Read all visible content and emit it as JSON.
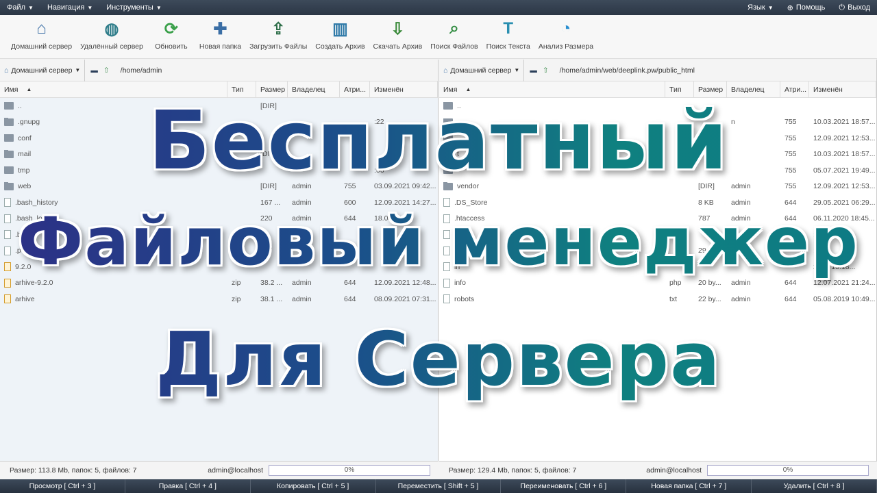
{
  "menubar": {
    "file": "Файл",
    "nav": "Навигация",
    "tools": "Инструменты",
    "lang": "Язык",
    "help": "Помощь",
    "exit": "Выход"
  },
  "toolbar": [
    {
      "label": "Домашний сервер",
      "icon": "home-icon"
    },
    {
      "label": "Удалённый сервер",
      "icon": "remote-server-icon"
    },
    {
      "label": "Обновить",
      "icon": "refresh-icon"
    },
    {
      "label": "Новая папка",
      "icon": "new-folder-icon"
    },
    {
      "label": "Загрузить Файлы",
      "icon": "upload-icon"
    },
    {
      "label": "Создать Архив",
      "icon": "archive-icon"
    },
    {
      "label": "Скачать Архив",
      "icon": "download-archive-icon"
    },
    {
      "label": "Поиск Файлов",
      "icon": "search-files-icon"
    },
    {
      "label": "Поиск Текста",
      "icon": "search-text-icon"
    },
    {
      "label": "Анализ Размера",
      "icon": "size-analysis-icon"
    }
  ],
  "left": {
    "server": "Домашний сервер",
    "path": "/home/admin",
    "columns": [
      "Имя",
      "Тип",
      "Размер",
      "Владелец",
      "Атри...",
      "Изменён"
    ],
    "rows": [
      {
        "kind": "folder",
        "name": "..",
        "type": "",
        "size": "[DIR]",
        "owner": "",
        "attr": "",
        "date": ""
      },
      {
        "kind": "folder",
        "name": ".gnupg",
        "type": "",
        "size": "",
        "owner": "",
        "attr": "",
        "date": ":22"
      },
      {
        "kind": "folder",
        "name": "conf",
        "type": "",
        "size": "",
        "owner": "",
        "attr": "",
        "date": ""
      },
      {
        "kind": "folder",
        "name": "mail",
        "type": "",
        "size": "[DIR]",
        "owner": "",
        "attr": "",
        "date": ""
      },
      {
        "kind": "folder",
        "name": "tmp",
        "type": "",
        "size": "",
        "owner": "",
        "attr": "",
        "date": ":06"
      },
      {
        "kind": "folder",
        "name": "web",
        "type": "",
        "size": "[DIR]",
        "owner": "admin",
        "attr": "755",
        "date": "03.09.2021 09:42..."
      },
      {
        "kind": "file",
        "name": ".bash_history",
        "type": "",
        "size": "167 ...",
        "owner": "admin",
        "attr": "600",
        "date": "12.09.2021 14:27..."
      },
      {
        "kind": "file",
        "name": ".bash_log",
        "type": "",
        "size": "220",
        "owner": "admin",
        "attr": "644",
        "date": "18.04.201"
      },
      {
        "kind": "file",
        "name": ".ba",
        "type": "",
        "size": "",
        "owner": "",
        "attr": "",
        "date": ""
      },
      {
        "kind": "file",
        "name": ".p",
        "type": "",
        "size": "807",
        "owner": "",
        "attr": "",
        "date": ""
      },
      {
        "kind": "zip",
        "name": "9.2.0",
        "type": "",
        "size": "",
        "owner": "",
        "attr": "",
        "date": ""
      },
      {
        "kind": "zip",
        "name": "arhive-9.2.0",
        "type": "zip",
        "size": "38.2 ...",
        "owner": "admin",
        "attr": "644",
        "date": "12.09.2021 12:48..."
      },
      {
        "kind": "zip",
        "name": "arhive",
        "type": "zip",
        "size": "38.1 ...",
        "owner": "admin",
        "attr": "644",
        "date": "08.09.2021 07:31..."
      }
    ],
    "status": "Размер: 113.8 Mb, папок: 5, файлов: 7",
    "user": "admin@localhost",
    "progress": "0%"
  },
  "right": {
    "server": "Домашний сервер",
    "path": "/home/admin/web/deeplink.pw/public_html",
    "columns": [
      "Имя",
      "Тип",
      "Размер",
      "Владелец",
      "Атри...",
      "Изменён"
    ],
    "rows": [
      {
        "kind": "folder",
        "name": "..",
        "type": "",
        "size": "",
        "owner": "",
        "attr": "",
        "date": ""
      },
      {
        "kind": "folder",
        "name": "",
        "type": "",
        "size": "",
        "owner": "n",
        "attr": "755",
        "date": "10.03.2021 18:57..."
      },
      {
        "kind": "folder",
        "name": "",
        "type": "",
        "size": "",
        "owner": "",
        "attr": "755",
        "date": "12.09.2021 12:53..."
      },
      {
        "kind": "folder",
        "name": "t",
        "type": "",
        "size": "",
        "owner": "",
        "attr": "755",
        "date": "10.03.2021 18:57..."
      },
      {
        "kind": "folder",
        "name": "",
        "type": "",
        "size": "",
        "owner": "",
        "attr": "755",
        "date": "05.07.2021 19:49..."
      },
      {
        "kind": "folder",
        "name": "vendor",
        "type": "",
        "size": "[DIR]",
        "owner": "admin",
        "attr": "755",
        "date": "12.09.2021 12:53..."
      },
      {
        "kind": "file",
        "name": ".DS_Store",
        "type": "",
        "size": "8 KB",
        "owner": "admin",
        "attr": "644",
        "date": "29.05.2021 06:29..."
      },
      {
        "kind": "file",
        "name": ".htaccess",
        "type": "",
        "size": "787",
        "owner": "admin",
        "attr": "644",
        "date": "06.11.2020 18:45..."
      },
      {
        "kind": "file",
        "name": "co",
        "type": "",
        "size": "",
        "owner": "",
        "attr": "",
        "date": ":48..."
      },
      {
        "kind": "file",
        "name": "de",
        "type": "",
        "size": "29",
        "owner": "",
        "attr": "",
        "date": ":48..."
      },
      {
        "kind": "file",
        "name": "in",
        "type": "",
        "size": "",
        "owner": "",
        "attr": "",
        "date": "2021 15:18..."
      },
      {
        "kind": "file",
        "name": "info",
        "type": "php",
        "size": "20 by...",
        "owner": "admin",
        "attr": "644",
        "date": "12.07.2021 21:24..."
      },
      {
        "kind": "file",
        "name": "robots",
        "type": "txt",
        "size": "22 by...",
        "owner": "admin",
        "attr": "644",
        "date": "05.08.2019 10:49..."
      }
    ],
    "status": "Размер: 129.4 Mb, папок: 5, файлов: 7",
    "user": "admin@localhost",
    "progress": "0%"
  },
  "fkeys": [
    "Просмотр [ Ctrl + 3 ]",
    "Правка [ Ctrl + 4 ]",
    "Копировать [ Ctrl + 5 ]",
    "Переместить [ Shift + 5 ]",
    "Переименовать [ Ctrl + 6 ]",
    "Новая папка [ Ctrl + 7 ]",
    "Удалить [ Ctrl + 8 ]"
  ],
  "overlay": {
    "line1": "Бесплатный",
    "line2": "Файловый менеджер",
    "line3": "Для Сервера"
  },
  "colors": {
    "menubar": "#2b3645",
    "title_start": "#2d2f86",
    "title_end": "#0e7a84"
  }
}
